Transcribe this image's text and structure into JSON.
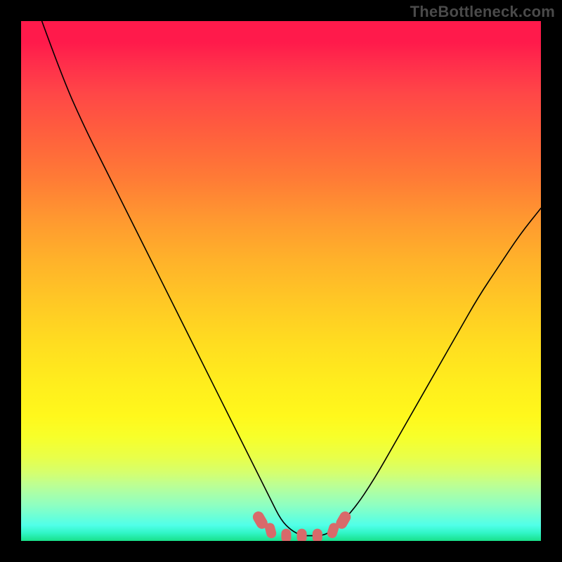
{
  "watermark": "TheBottleneck.com",
  "chart_data": {
    "type": "line",
    "title": "",
    "xlabel": "",
    "ylabel": "",
    "xlim": [
      0,
      100
    ],
    "ylim": [
      0,
      100
    ],
    "grid": false,
    "legend": false,
    "series": [
      {
        "name": "bottleneck-curve",
        "x": [
          4,
          8,
          12,
          16,
          20,
          24,
          28,
          32,
          36,
          40,
          43,
          46,
          48,
          50,
          52,
          54,
          56,
          58,
          60,
          64,
          68,
          72,
          76,
          80,
          84,
          88,
          92,
          96,
          100
        ],
        "y": [
          100,
          89,
          80,
          72,
          64,
          56,
          48,
          40,
          32,
          24,
          18,
          12,
          8,
          4,
          2,
          1,
          1,
          1,
          2,
          6,
          12,
          19,
          26,
          33,
          40,
          47,
          53,
          59,
          64
        ]
      }
    ],
    "markers": {
      "name": "highlight-points",
      "color": "#d86a6a",
      "points": [
        {
          "x": 46,
          "y": 4
        },
        {
          "x": 48,
          "y": 2
        },
        {
          "x": 51,
          "y": 1
        },
        {
          "x": 54,
          "y": 1
        },
        {
          "x": 57,
          "y": 1
        },
        {
          "x": 60,
          "y": 2
        },
        {
          "x": 62,
          "y": 4
        }
      ]
    },
    "background_gradient": {
      "top": "#ff1a4b",
      "upper_mid": "#ffb22a",
      "lower_mid": "#fff81c",
      "bottom": "#19e08a"
    }
  }
}
